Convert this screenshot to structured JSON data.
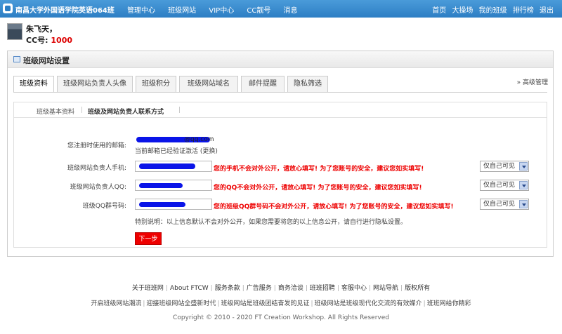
{
  "topbar": {
    "site_name": "南昌大学外国语学院英语064班",
    "nav": [
      "管理中心",
      "班级网站",
      "VIP中心",
      "CC靓号",
      "消息"
    ],
    "right_links": [
      "首页",
      "大操场",
      "我的班级",
      "排行榜",
      "退出"
    ],
    "bg_color": "#2d7ec4"
  },
  "user": {
    "name": "朱飞天，",
    "cc_label": "CC号:",
    "cc_number": "1000"
  },
  "panel": {
    "title": "班级网站设置",
    "tabs": [
      "班级资料",
      "班级网站负责人头像",
      "班级积分",
      "班级网站域名",
      "邮件提醒",
      "隐私筛选"
    ],
    "active_tab": "班级资料",
    "advanced_link": "» 高级管理",
    "subtabs": [
      "班级基本资料",
      "班级及网站负责人联系方式"
    ],
    "active_subtab": "班级及网站负责人联系方式"
  },
  "form": {
    "email_label": "您注册时使用的邮箱:",
    "email_value": "@qq.com",
    "email_verified": "当前邮箱已经验证激活 (更换)",
    "phone_label": "班级网站负责人手机:",
    "phone_warning": "您的手机不会对外公开，请放心填写! 为了您账号的安全，建议您如实填写!",
    "qq_label": "班级网站负责人QQ:",
    "qq_warning": "您的QQ不会对外公开，请放心填写! 为了您账号的安全，建议您如实填写!",
    "group_label": "班级QQ群号码:",
    "group_warning": "您的班级QQ群号码不会对外公开，请放心填写! 为了您账号的安全，建议您如实填写!",
    "privacy_option": "仅自己可见",
    "note": "特别说明：以上信息默认不会对外公开，如果您需要将您的以上信息公开，请自行进行隐私设置。",
    "next_button": "下一步",
    "warning_color": "#e00000"
  },
  "footer": {
    "links": [
      "关于班班网",
      "About FTCW",
      "服务条款",
      "广告服务",
      "商务洽谈",
      "班班招聘",
      "客服中心",
      "网站导航",
      "版权所有"
    ],
    "slogans": [
      "开启班级网站潮流",
      "迎接班级网站全盛新时代",
      "班级网站是班级团结奋发的见证",
      "班级网站是班级现代化交流的有效媒介",
      "班班网给你精彩"
    ],
    "copyright": "Copyright © 2010 - 2020 FT Creation Workshop. All Rights Reserved"
  }
}
